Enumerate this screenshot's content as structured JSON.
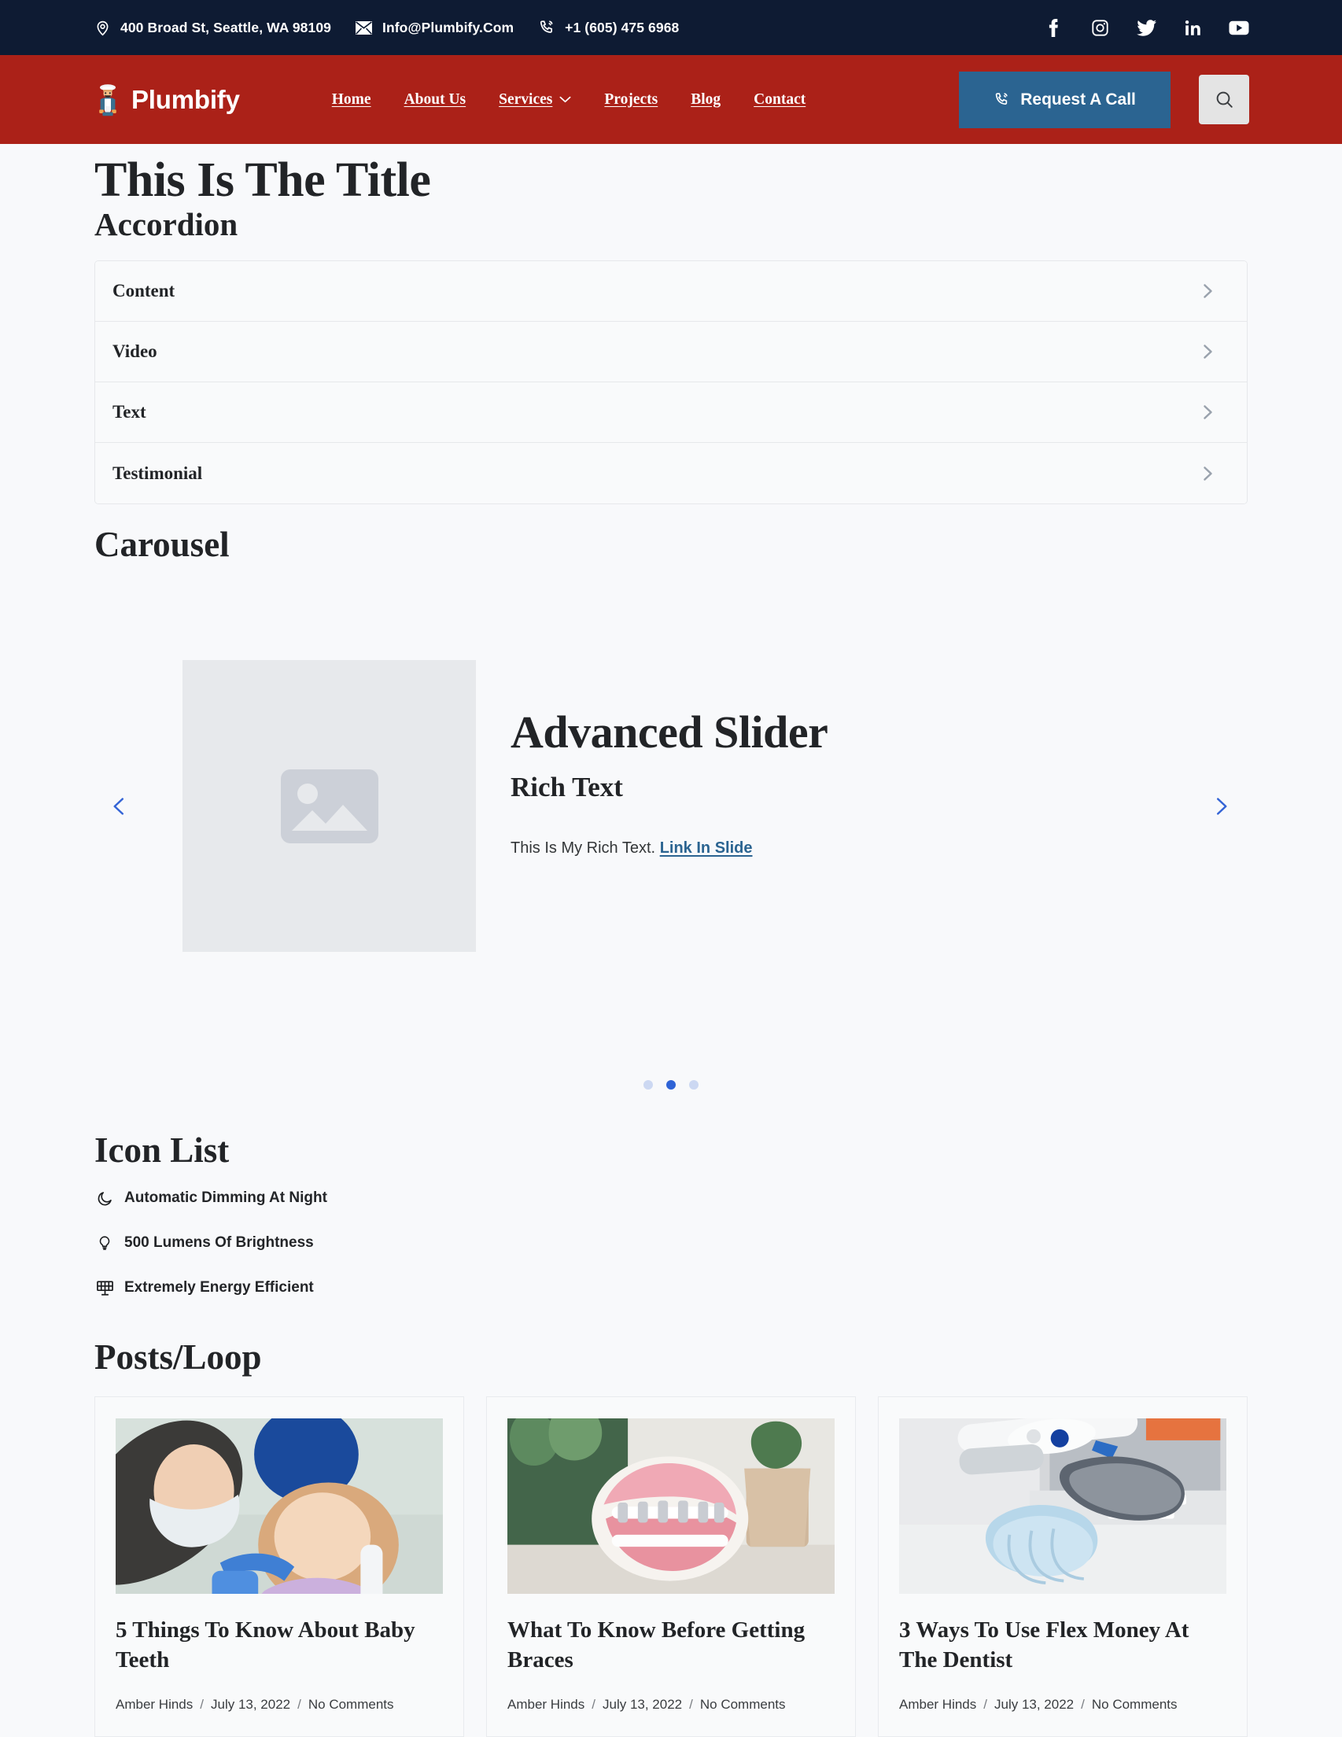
{
  "topbar": {
    "address": "400 Broad St, Seattle, WA 98109",
    "email": "Info@Plumbify.Com",
    "phone": "+1 (605) 475 6968",
    "address_icon": "location-pin-icon",
    "email_icon": "envelope-icon",
    "phone_icon": "phone-ring-icon",
    "socials": [
      {
        "name": "facebook",
        "label": "Facebook"
      },
      {
        "name": "instagram",
        "label": "Instagram"
      },
      {
        "name": "twitter",
        "label": "Twitter"
      },
      {
        "name": "linkedin",
        "label": "LinkedIn"
      },
      {
        "name": "youtube",
        "label": "YouTube"
      }
    ]
  },
  "header": {
    "brand": "Plumbify",
    "brand_icon": "plumber-worker-icon",
    "nav": [
      {
        "label": "Home",
        "has_dropdown": false
      },
      {
        "label": "About Us",
        "has_dropdown": false
      },
      {
        "label": "Services",
        "has_dropdown": true
      },
      {
        "label": "Projects",
        "has_dropdown": false
      },
      {
        "label": "Blog",
        "has_dropdown": false
      },
      {
        "label": "Contact",
        "has_dropdown": false
      }
    ],
    "cta_label": "Request A Call",
    "cta_icon": "phone-ring-icon",
    "search_icon": "search-icon",
    "colors": {
      "topbar_bg": "#0e1b33",
      "header_bg": "#ab2118",
      "cta_bg": "#2b6491",
      "search_bg": "#e4e4e4"
    }
  },
  "main": {
    "page_title": "This Is The Title",
    "accordion": {
      "heading": "Accordion",
      "items": [
        {
          "label": "Content",
          "icon": "chevron-right-icon"
        },
        {
          "label": "Video",
          "icon": "chevron-right-icon"
        },
        {
          "label": "Text",
          "icon": "chevron-right-icon"
        },
        {
          "label": "Testimonial",
          "icon": "chevron-right-icon"
        }
      ]
    },
    "carousel": {
      "heading": "Carousel",
      "prev_icon": "chevron-left-icon",
      "next_icon": "chevron-right-icon",
      "slide": {
        "image_placeholder_icon": "image-placeholder-icon",
        "title": "Advanced Slider",
        "subtitle": "Rich Text",
        "rich_text": "This Is My Rich Text.",
        "link_label": "Link In Slide"
      },
      "dots": [
        {
          "active": false
        },
        {
          "active": true
        },
        {
          "active": false
        }
      ],
      "active_dot_color": "#2f63d6",
      "inactive_dot_color": "#ccd8f2"
    },
    "icon_list": {
      "heading": "Icon List",
      "items": [
        {
          "icon": "moon-icon",
          "label": "Automatic Dimming At Night"
        },
        {
          "icon": "lightbulb-icon",
          "label": "500 Lumens Of Brightness"
        },
        {
          "icon": "solar-panel-icon",
          "label": "Extremely Energy Efficient"
        }
      ]
    },
    "posts": {
      "heading": "Posts/Loop",
      "items": [
        {
          "title": "5 Things To Know About Baby Teeth",
          "author": "Amber Hinds",
          "date": "July 13, 2022",
          "comments": "No Comments",
          "image_alt": "dentist-with-child-patient"
        },
        {
          "title": "What To Know Before Getting Braces",
          "author": "Amber Hinds",
          "date": "July 13, 2022",
          "comments": "No Comments",
          "image_alt": "dental-braces-model"
        },
        {
          "title": "3 Ways To Use Flex Money At The Dentist",
          "author": "Amber Hinds",
          "date": "July 13, 2022",
          "comments": "No Comments",
          "image_alt": "dental-tools-and-mask-on-desk"
        }
      ],
      "separator": "/"
    }
  }
}
